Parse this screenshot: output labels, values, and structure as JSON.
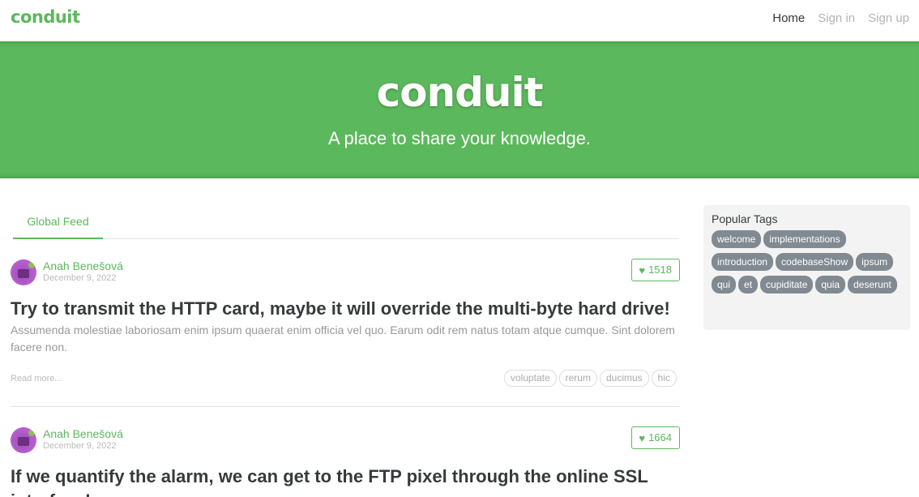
{
  "navbar": {
    "brand": "conduit",
    "links": [
      "Home",
      "Sign in",
      "Sign up"
    ]
  },
  "banner": {
    "title": "conduit",
    "subtitle": "A place to share your knowledge."
  },
  "feed": {
    "tabs": [
      "Global Feed"
    ]
  },
  "articles": [
    {
      "author": "Anah Benešová",
      "date": "December 9, 2022",
      "likes": "1518",
      "title": "Try to transmit the HTTP card, maybe it will override the multi-byte hard drive!",
      "description": "Assumenda molestiae laboriosam enim ipsum quaerat enim officia vel quo. Earum odit rem natus totam atque cumque. Sint dolorem facere non.",
      "read_more": "Read more...",
      "tags": [
        "voluptate",
        "rerum",
        "ducimus",
        "hic"
      ]
    },
    {
      "author": "Anah Benešová",
      "date": "December 9, 2022",
      "likes": "1664",
      "title": "If we quantify the alarm, we can get to the FTP pixel through the online SSL interface!"
    }
  ],
  "sidebar": {
    "title": "Popular Tags",
    "tags": [
      "welcome",
      "implementations",
      "introduction",
      "codebaseShow",
      "ipsum",
      "qui",
      "et",
      "cupiditate",
      "quia",
      "deserunt"
    ]
  },
  "colors": {
    "brand": "#5cb85c",
    "tag_pill": "#818a91"
  },
  "icons": {
    "like": "heart-icon",
    "avatar": "avatar-image"
  }
}
